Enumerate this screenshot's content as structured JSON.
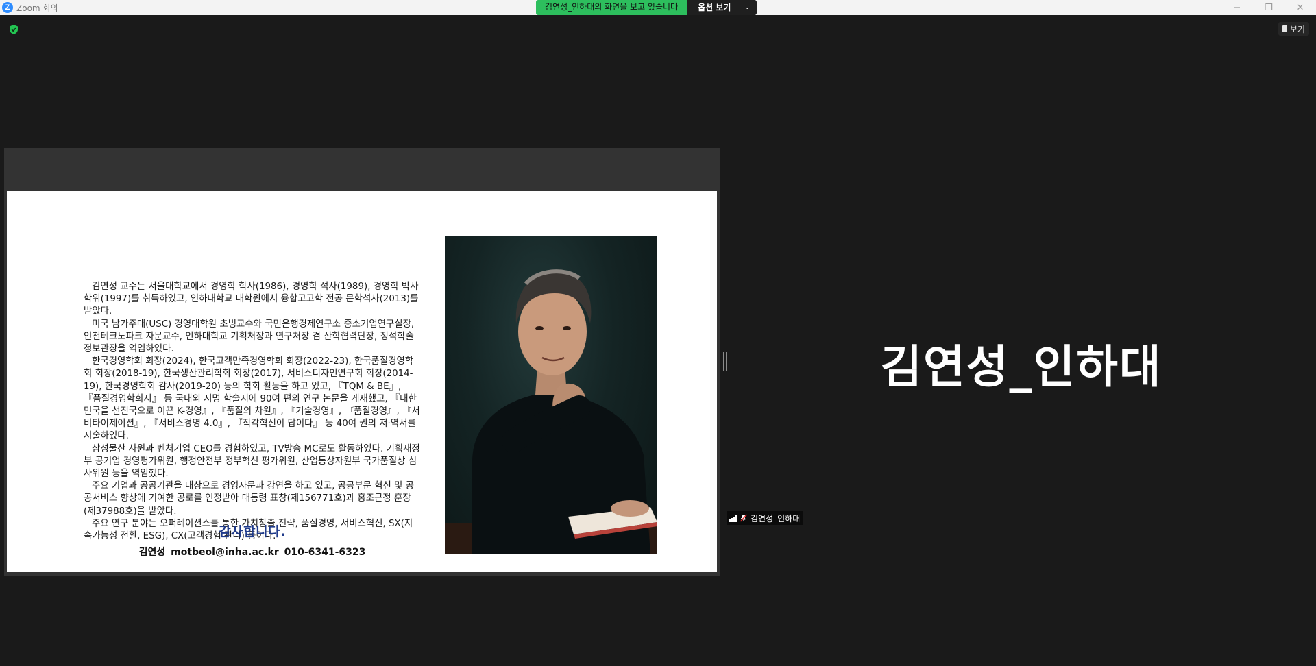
{
  "titlebar": {
    "title": "Zoom 회의",
    "logo_letter": "Z",
    "controls": {
      "minimize": "−",
      "restore": "❐",
      "close": "✕"
    }
  },
  "share_bar": {
    "message": "김연성_인하대의 화면을 보고 있습니다",
    "options_label": "옵션 보기",
    "options_chevron": "⌄"
  },
  "view_button": {
    "label": "보기"
  },
  "slide": {
    "paragraphs": [
      "김연성 교수는 서울대학교에서 경영학 학사(1986), 경영학 석사(1989), 경영학 박사학위(1997)를 취득하였고, 인하대학교 대학원에서 융합고고학 전공 문학석사(2013)를 받았다.",
      "미국 남가주대(USC) 경영대학원 초빙교수와 국민은행경제연구소 중소기업연구실장, 인천테크노파크 자문교수, 인하대학교 기획처장과 연구처장 겸 산학협력단장, 정석학술정보관장을 역임하였다.",
      "한국경영학회 회장(2024), 한국고객만족경영학회 회장(2022-23), 한국품질경영학회 회장(2018-19), 한국생산관리학회 회장(2017), 서비스디자인연구회 회장(2014-19), 한국경영학회 감사(2019-20) 등의 학회 활동을 하고 있고, 『TQM & BE』, 『품질경영학회지』 등 국내외 저명 학술지에 90여 편의 연구 논문을 게재했고, 『대한민국을 선진국으로 이끈 K-경영』, 『품질의 차원』, 『기술경영』, 『품질경영』, 『서비타이제이션』, 『서비스경영 4.0』, 『직각혁신이 답이다』 등 40여 권의 저·역서를 저술하였다.",
      "삼성물산 사원과 벤처기업 CEO를 경험하였고, TV방송 MC로도 활동하였다. 기획재정부 공기업 경영평가위원, 행정안전부 정부혁신 평가위원, 산업통상자원부 국가품질상 심사위원 등을 역임했다.",
      "주요 기업과 공공기관을 대상으로 경영자문과 강연을 하고 있고, 공공부문 혁신 및 공공서비스 향상에 기여한 공로를 인정받아 대통령 표창(제156771호)과 홍조근정 훈장(제37988호)을 받았다.",
      "주요 연구 분야는 오퍼레이션스를 통한 가치창출 전략, 품질경영, 서비스혁신, SX(지속가능성 전환, ESG), CX(고객경험 관리) 등이다."
    ],
    "thanks": "감사합니다.",
    "contact": "김연성   motbeol@inha.ac.kr   010-6341-6323"
  },
  "participant": {
    "display_name": "김연성_인하대",
    "tag_name": "김연성_인하대"
  },
  "colors": {
    "share_green": "#2dbe5d",
    "thanks_blue": "#1f3a8a",
    "background": "#1a1a1a",
    "shield_green": "#23c552"
  }
}
